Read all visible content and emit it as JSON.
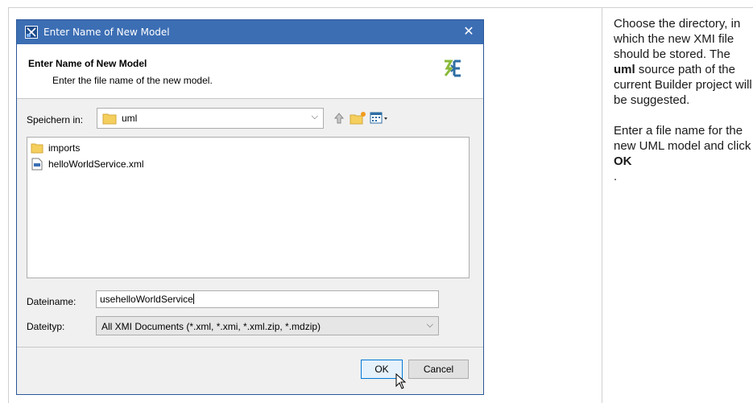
{
  "dialog": {
    "title": "Enter Name of New Model",
    "header_title": "Enter Name of New Model",
    "header_desc": "Enter the file name of the new model.",
    "save_in_label": "Speichern in:",
    "save_in_value": "uml",
    "files": [
      {
        "name": "imports",
        "icon": "folder-icon"
      },
      {
        "name": "helloWorldService.xml",
        "icon": "xml-file-icon"
      }
    ],
    "filename_label": "Dateiname:",
    "filename_value": "usehelloWorldService",
    "filetype_label": "Dateityp:",
    "filetype_value": "All XMI Documents (*.xml, *.xmi, *.xml.zip, *.mdzip)",
    "ok_label": "OK",
    "cancel_label": "Cancel",
    "colors": {
      "titlebar": "#3c6eb4",
      "ok_border": "#0078d7"
    }
  },
  "instructions": {
    "p1_a": "Choose the directory, in which the new XMI file should be stored. The ",
    "p1_bold": "uml",
    "p1_b": " source path of the current Builder project will be suggested.",
    "p2_a": "Enter a file name for the new UML model and click ",
    "p2_bold": "OK",
    "p2_b": "."
  }
}
